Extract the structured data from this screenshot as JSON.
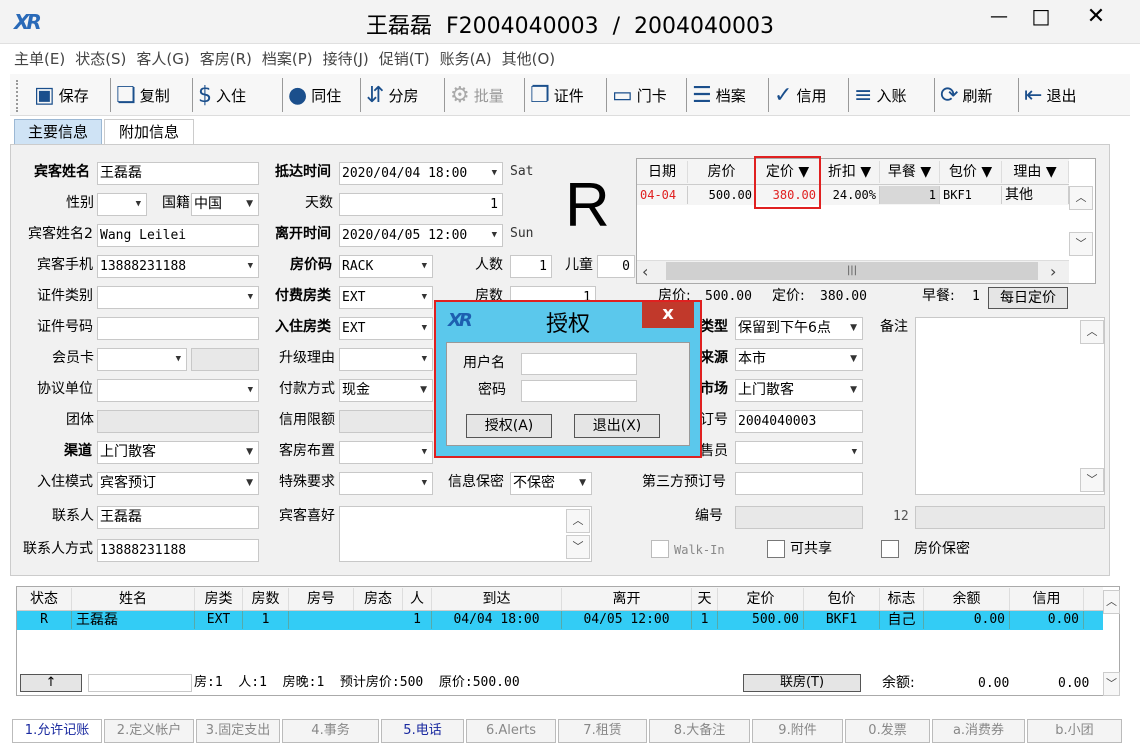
{
  "window": {
    "title": "王磊磊  F2004040003  /  2004040003",
    "min": "—",
    "max": "□",
    "close": "✕"
  },
  "menu": [
    "主单(E)",
    "状态(S)",
    "客人(G)",
    "客房(R)",
    "档案(P)",
    "接待(J)",
    "促销(T)",
    "账务(A)",
    "其他(O)"
  ],
  "toolbar": [
    {
      "label": "保存",
      "icon": "save-icon"
    },
    {
      "label": "复制",
      "icon": "copy-icon"
    },
    {
      "label": "入住",
      "icon": "money-bag-icon"
    },
    {
      "label": "同住",
      "icon": "person-icon"
    },
    {
      "label": "分房",
      "icon": "split-room-icon"
    },
    {
      "label": "批量",
      "icon": "gear-icon"
    },
    {
      "label": "证件",
      "icon": "id-copy-icon"
    },
    {
      "label": "门卡",
      "icon": "card-icon"
    },
    {
      "label": "档案",
      "icon": "profile-card-icon"
    },
    {
      "label": "信用",
      "icon": "shield-check-icon"
    },
    {
      "label": "入账",
      "icon": "post-icon"
    },
    {
      "label": "刷新",
      "icon": "refresh-icon"
    },
    {
      "label": "退出",
      "icon": "exit-icon"
    }
  ],
  "tabs": {
    "main": "主要信息",
    "extra": "附加信息"
  },
  "form": {
    "guest_name_label": "宾客姓名",
    "guest_name": "王磊磊",
    "gender_label": "性别",
    "gender": "",
    "nationality_label": "国籍",
    "nationality": "中国",
    "guest_name2_label": "宾客姓名2",
    "guest_name2": "Wang Leilei",
    "mobile_label": "宾客手机",
    "mobile": "13888231188",
    "id_type_label": "证件类别",
    "id_type": "",
    "id_no_label": "证件号码",
    "id_no": "",
    "member_label": "会员卡",
    "member": "",
    "company_label": "协议单位",
    "company": "",
    "group_label": "团体",
    "group": "",
    "channel_label": "渠道",
    "channel": "上门散客",
    "checkin_mode_label": "入住模式",
    "checkin_mode": "宾客预订",
    "contact_label": "联系人",
    "contact": "王磊磊",
    "contact_method_label": "联系人方式",
    "contact_method": "13888231188",
    "arrival_label": "抵达时间",
    "arrival": "2020/04/04 18:00",
    "arrival_day": "Sat",
    "days_label": "天数",
    "days": "1",
    "departure_label": "离开时间",
    "departure": "2020/04/05 12:00",
    "departure_day": "Sun",
    "rate_code_label": "房价码",
    "rate_code": "RACK",
    "adults_label": "人数",
    "adults": "1",
    "children_label": "儿童",
    "children": "0",
    "pay_room_label": "付费房类",
    "pay_room": "EXT",
    "room_count_label": "房数",
    "room_count": "1",
    "stay_room_label": "入住房类",
    "stay_room": "EXT",
    "upgrade_label": "升级理由",
    "upgrade": "",
    "payment_label": "付款方式",
    "payment": "现金",
    "credit_label": "信用限额",
    "credit": "",
    "layout_label": "客房布置",
    "layout": "",
    "special_label": "特殊要求",
    "special": "",
    "privacy_label": "信息保密",
    "privacy": "不保密",
    "preference_label": "宾客喜好",
    "preference": "",
    "status_letter": "R",
    "res_type_label": "类型",
    "res_type": "保留到下午6点",
    "source_label": "来源",
    "source": "本市",
    "market_label": "市场",
    "market": "上门散客",
    "order_label": "订号",
    "order": "2004040003",
    "sales_label": "售员",
    "sales": "",
    "third_label": "第三方预订号",
    "third": "",
    "code_label": "编号",
    "code": "",
    "num12": "12",
    "remark_label": "备注",
    "walkin_label": "Walk-In",
    "share_label": "可共享",
    "rate_secret_label": "房价保密"
  },
  "rate_grid": {
    "headers": [
      "日期",
      "房价",
      "定价 ▼",
      "折扣 ▼",
      "早餐 ▼",
      "包价 ▼",
      "理由 ▼"
    ],
    "row": [
      "04-04",
      "500.00",
      "380.00",
      "24.00%",
      "1",
      "BKF1",
      "其他"
    ],
    "summary_rate_label": "房价:",
    "summary_rate": "500.00",
    "summary_fixed_label": "定价:",
    "summary_fixed": "380.00",
    "summary_bf_label": "早餐:",
    "summary_bf": "1",
    "daily_button": "每日定价"
  },
  "dialog": {
    "title": "授权",
    "user_label": "用户名",
    "user": "",
    "pwd_label": "密码",
    "pwd": "",
    "ok": "授权(A)",
    "cancel": "退出(X)",
    "close": "x"
  },
  "list": {
    "headers": [
      "状态",
      "姓名",
      "房类",
      "房数",
      "房号",
      "房态",
      "人",
      "到达",
      "离开",
      "天",
      "定价",
      "包价",
      "标志",
      "余额",
      "信用"
    ],
    "row": [
      "R",
      "王磊磊",
      "EXT",
      "1",
      "",
      "",
      "1",
      "04/04 18:00",
      "04/05 12:00",
      "1",
      "500.00",
      "BKF1",
      "自己",
      "0.00",
      "0.00"
    ],
    "up_button": "↑",
    "summary": "房:1  人:1  房晚:1  预计房价:500  原价:500.00",
    "link_button": "联房(T)",
    "balance_label": "余额:",
    "balance": "0.00",
    "balance2": "0.00"
  },
  "bottom_tabs": [
    "1.允许记账",
    "2.定义帐户",
    "3.固定支出",
    "4.事务",
    "5.电话",
    "6.Alerts",
    "7.租赁",
    "8.大备注",
    "9.附件",
    "0.发票",
    "a.消费券",
    "b.小团"
  ],
  "colors": {
    "highlight_row": "#33ccf5",
    "dialog_bg": "#5bc8ec",
    "red": "#e02020",
    "title_bg": "#f3f3f3"
  }
}
